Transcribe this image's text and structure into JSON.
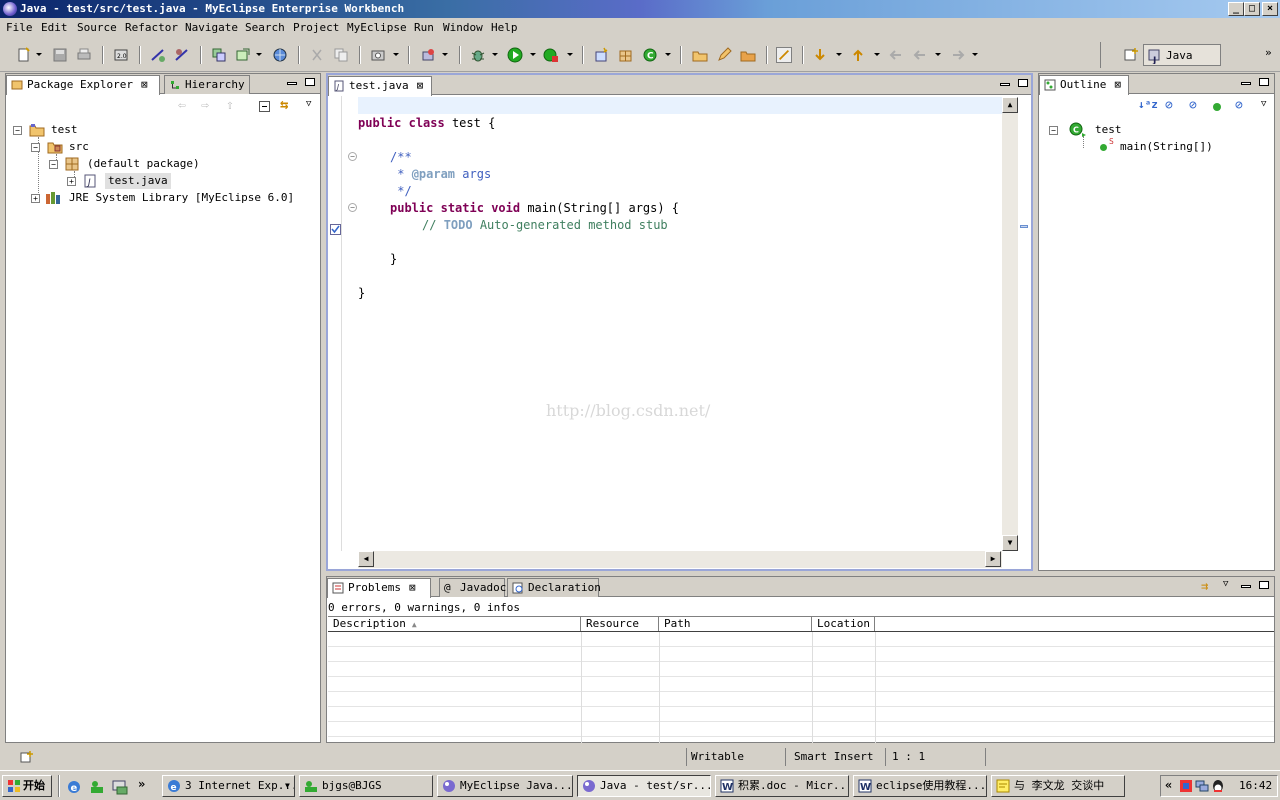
{
  "window": {
    "title": "Java - test/src/test.java - MyEclipse Enterprise Workbench",
    "controls": [
      "_",
      "□",
      "×"
    ]
  },
  "menu": [
    "File",
    "Edit",
    "Source",
    "Refactor",
    "Navigate",
    "Search",
    "Project",
    "MyEclipse",
    "Run",
    "Window",
    "Help"
  ],
  "perspective": {
    "label": "Java"
  },
  "package_explorer": {
    "tabs": [
      {
        "label": "Package Explorer"
      },
      {
        "label": "Hierarchy"
      }
    ],
    "tree": [
      {
        "label": "test"
      },
      {
        "label": "src"
      },
      {
        "label": "(default package)"
      },
      {
        "label": "test.java"
      },
      {
        "label": "JRE System Library [MyEclipse 6.0]"
      }
    ]
  },
  "editor": {
    "tab": "test.java",
    "lines": {
      "l1_kw1": "public",
      "l1_kw2": "class",
      "l1_rest": " test {",
      "l3": "/**",
      "l4_star": " * ",
      "l4_tag": "@param",
      "l4_rest": " args",
      "l5": " */",
      "l6_kw1": "public",
      "l6_kw2": "static",
      "l6_kw3": "void",
      "l6_rest": " main(String[] args) {",
      "l7_slash": "// ",
      "l7_todo": "TODO",
      "l7_rest": " Auto-generated method stub",
      "l9": "}",
      "l11": "}"
    },
    "watermark": "http://blog.csdn.net/"
  },
  "outline": {
    "tab": "Outline",
    "items": [
      {
        "label": "test"
      },
      {
        "label": "main(String[])"
      }
    ],
    "static_marker": "S"
  },
  "bottom": {
    "tabs": [
      {
        "label": "Problems"
      },
      {
        "label": "Javadoc"
      },
      {
        "label": "Declaration"
      }
    ],
    "summary": "0 errors, 0 warnings, 0 infos",
    "columns": [
      "Description",
      "Resource",
      "Path",
      "Location"
    ]
  },
  "status": {
    "writable": "Writable",
    "insert": "Smart Insert",
    "position": "1 : 1"
  },
  "taskbar": {
    "start": "开始",
    "tasks": [
      {
        "label": "3 Internet Exp..."
      },
      {
        "label": "bjgs@BJGS"
      },
      {
        "label": "MyEclipse Java..."
      },
      {
        "label": "Java - test/sr..."
      },
      {
        "label": "积累.doc - Micr..."
      },
      {
        "label": "eclipse使用教程..."
      },
      {
        "label": "与 李文龙 交谈中"
      }
    ],
    "clock": "16:42",
    "quicklaunch_more": "»",
    "tray_more": "«"
  }
}
